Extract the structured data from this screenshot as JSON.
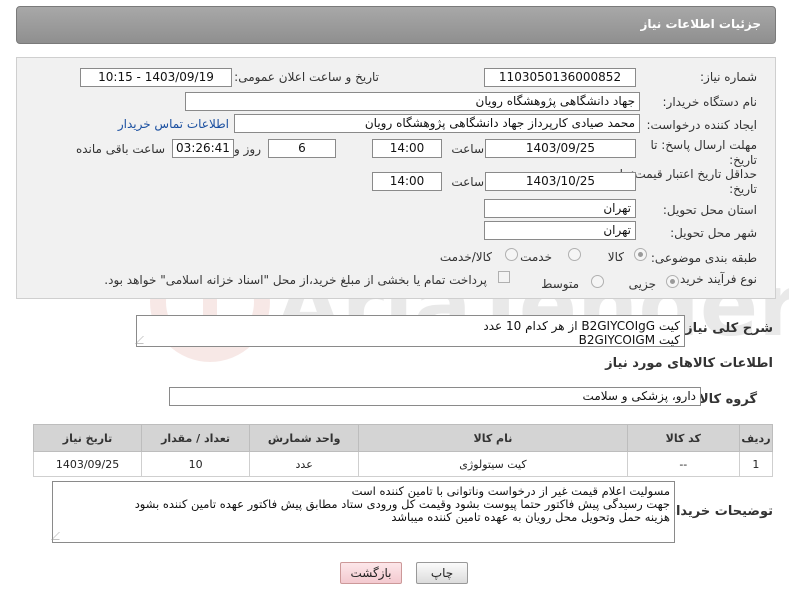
{
  "header": {
    "title": "جزئیات اطلاعات نیاز"
  },
  "form": {
    "need_number_label": "شماره نیاز:",
    "need_number": "1103050136000852",
    "announce_label": "تاریخ و ساعت اعلان عمومی:",
    "announce_value": "1403/09/19 - 10:15",
    "buyer_org_label": "نام دستگاه خریدار:",
    "buyer_org": "جهاد دانشگاهی پژوهشگاه رویان",
    "requester_label": "ایجاد کننده درخواست:",
    "requester": "محمد صیادی کارپرداز جهاد دانشگاهی پژوهشگاه رویان",
    "contact_link": "اطلاعات تماس خریدار",
    "deadline_label_1": "مهلت ارسال پاسخ: تا",
    "deadline_label_2": "تاریخ:",
    "deadline_date": "1403/09/25",
    "time_label": "ساعت",
    "deadline_time": "14:00",
    "days_value": "6",
    "days_label": "روز و",
    "remaining_time": "03:26:41",
    "remaining_label": "ساعت باقی مانده",
    "validity_label_1": "حداقل تاریخ اعتبار قیمت: تا",
    "validity_label_2": "تاریخ:",
    "validity_date": "1403/10/25",
    "validity_time": "14:00",
    "province_label": "استان محل تحویل:",
    "province": "تهران",
    "city_label": "شهر محل تحویل:",
    "city": "تهران",
    "category_label": "طبقه بندی موضوعی:",
    "category_options": [
      "کالا",
      "خدمت",
      "کالا/خدمت"
    ],
    "process_label": "نوع فرآیند خرید :",
    "process_options": [
      "جزیی",
      "متوسط"
    ],
    "payment_note": "پرداخت تمام یا بخشی از مبلغ خرید،از محل \"اسناد خزانه اسلامی\" خواهد بود."
  },
  "description": {
    "label": "شرح کلی نیاز:",
    "line1": "کیت  B2GIYCOIgG  از هر کدام 10 عدد",
    "line2": "کیت B2GIYCOIGM"
  },
  "goods": {
    "section_title": "اطلاعات کالاهای مورد نیاز",
    "group_label": "گروه کالا:",
    "group_value": "دارو، پزشکی و سلامت",
    "columns": [
      "ردیف",
      "کد کالا",
      "نام کالا",
      "واحد شمارش",
      "تعداد / مقدار",
      "تاریخ نیاز"
    ],
    "rows": [
      {
        "row": "1",
        "code": "--",
        "name": "کیت سیتولوژی",
        "unit": "عدد",
        "qty": "10",
        "date": "1403/09/25"
      }
    ]
  },
  "buyer_notes": {
    "label": "توضیحات خریدار:",
    "line1": "مسولیت اعلام قیمت  غیر از درخواست وناتوانی با تامین کننده است",
    "line2": "جهت رسیدگی پیش فاکتور حتما پیوست بشود وقیمت کل ورودی ستاد مطابق پیش فاکتور عهده تامین کننده بشود",
    "line3": "هزینه حمل وتحویل محل رویان به عهده تامین کننده میباشد"
  },
  "buttons": {
    "print": "چاپ",
    "back": "بازگشت"
  }
}
